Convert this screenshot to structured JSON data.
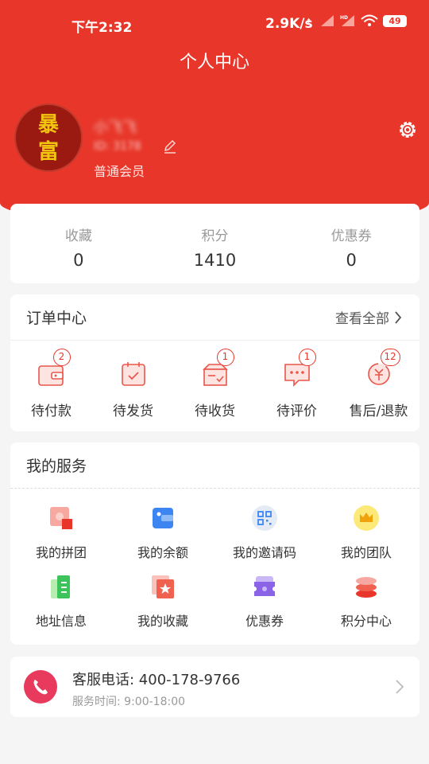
{
  "status_bar": {
    "time": "下午2:32",
    "network_speed": "2.9K/s",
    "battery": "49",
    "icons": [
      "bluetooth-icon",
      "signal-icon",
      "hd-signal-icon",
      "wifi-icon",
      "battery-icon"
    ]
  },
  "header": {
    "title": "个人中心",
    "avatar_text_top": "暴",
    "avatar_text_bottom": "富",
    "username": "小飞飞",
    "user_id": "ID: 3178",
    "member_level": "普通会员"
  },
  "stats": [
    {
      "label": "收藏",
      "value": "0"
    },
    {
      "label": "积分",
      "value": "1410"
    },
    {
      "label": "优惠券",
      "value": "0"
    }
  ],
  "orders": {
    "title": "订单中心",
    "view_all": "查看全部",
    "items": [
      {
        "label": "待付款",
        "badge": "2",
        "icon": "wallet-icon"
      },
      {
        "label": "待发货",
        "badge": "",
        "icon": "calendar-check-icon"
      },
      {
        "label": "待收货",
        "badge": "1",
        "icon": "box-icon"
      },
      {
        "label": "待评价",
        "badge": "1",
        "icon": "comment-icon"
      },
      {
        "label": "售后/退款",
        "badge": "12",
        "icon": "refund-icon"
      }
    ]
  },
  "services": {
    "title": "我的服务",
    "items": [
      {
        "label": "我的拼团",
        "icon": "puzzle-icon"
      },
      {
        "label": "我的余额",
        "icon": "wallet-card-icon"
      },
      {
        "label": "我的邀请码",
        "icon": "qrcode-icon"
      },
      {
        "label": "我的团队",
        "icon": "crown-icon"
      },
      {
        "label": "地址信息",
        "icon": "address-book-icon"
      },
      {
        "label": "我的收藏",
        "icon": "star-icon"
      },
      {
        "label": "优惠券",
        "icon": "coupon-icon"
      },
      {
        "label": "积分中心",
        "icon": "coins-icon"
      }
    ]
  },
  "customer_service": {
    "phone_label": "客服电话: 400-178-9766",
    "hours_label": "服务时间: 9:00-18:00"
  },
  "colors": {
    "brand_red": "#e8372a",
    "phone_pink": "#e83a5c"
  }
}
